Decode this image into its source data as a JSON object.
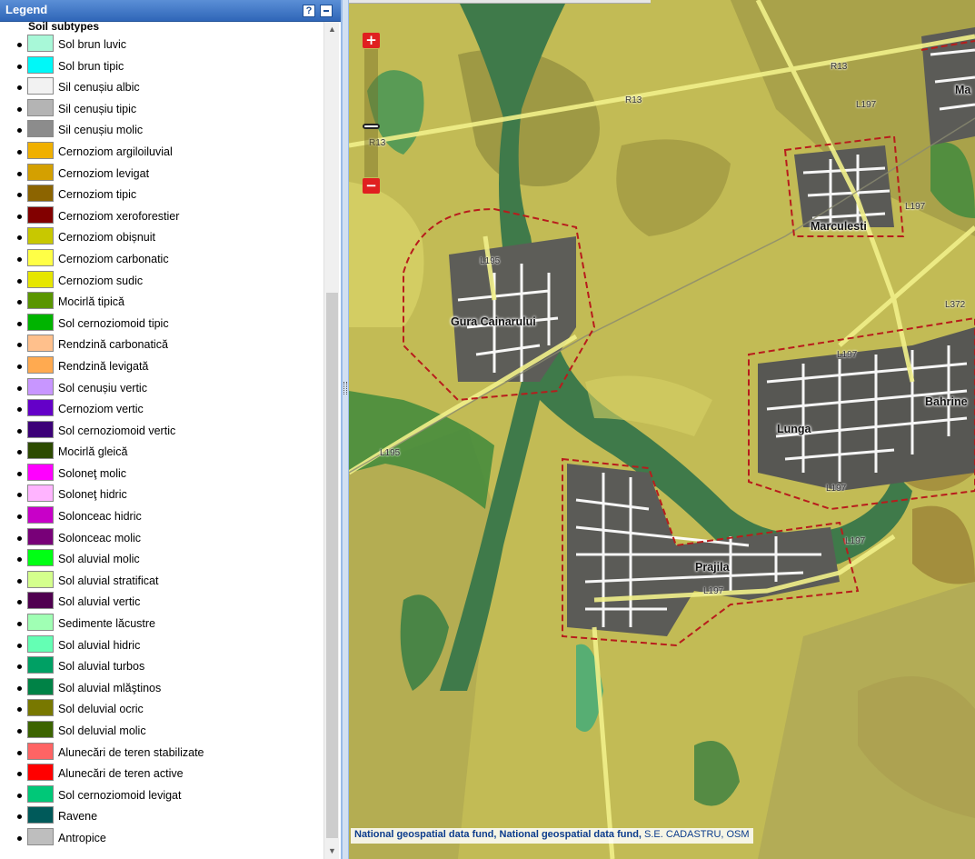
{
  "legend": {
    "title": "Legend",
    "help_label": "?",
    "subtitle": "Soil subtypes",
    "items": [
      {
        "label": "Sol brun luvic",
        "color": "#a8f8d8"
      },
      {
        "label": "Sol brun tipic",
        "color": "#00f8f8"
      },
      {
        "label": "Sil cenușiu albic",
        "color": "#f2f2f2"
      },
      {
        "label": "Sil cenușiu tipic",
        "color": "#b4b4b4"
      },
      {
        "label": "Sil cenușiu molic",
        "color": "#8c8c8c"
      },
      {
        "label": "Cernoziom argiloiluvial",
        "color": "#f0b000"
      },
      {
        "label": "Cernoziom levigat",
        "color": "#d4a000"
      },
      {
        "label": "Cernoziom tipic",
        "color": "#8c6400"
      },
      {
        "label": "Cernoziom xeroforestier",
        "color": "#820000"
      },
      {
        "label": "Cernoziom obișnuit",
        "color": "#c8c800"
      },
      {
        "label": "Cernoziom carbonatic",
        "color": "#ffff46"
      },
      {
        "label": "Cernoziom sudic",
        "color": "#e6e600"
      },
      {
        "label": "Mocirlă tipică",
        "color": "#5a9600"
      },
      {
        "label": "Sol cernoziomoid tipic",
        "color": "#00b400"
      },
      {
        "label": "Rendzină carbonatică",
        "color": "#ffc08c"
      },
      {
        "label": "Rendzină levigată",
        "color": "#ffaa50"
      },
      {
        "label": "Sol cenușiu vertic",
        "color": "#c896ff"
      },
      {
        "label": "Cernoziom vertic",
        "color": "#6400c8"
      },
      {
        "label": "Sol cernoziomoid vertic",
        "color": "#3c0078"
      },
      {
        "label": "Mocirlă gleică",
        "color": "#2d4b00"
      },
      {
        "label": "Soloneţ molic",
        "color": "#ff00ff"
      },
      {
        "label": "Soloneţ hidric",
        "color": "#ffb4ff"
      },
      {
        "label": "Solonceac hidric",
        "color": "#c800c8"
      },
      {
        "label": "Solonceac molic",
        "color": "#780078"
      },
      {
        "label": "Sol aluvial molic",
        "color": "#00ff14"
      },
      {
        "label": "Sol aluvial stratificat",
        "color": "#d4ff8c"
      },
      {
        "label": "Sol aluvial vertic",
        "color": "#500050"
      },
      {
        "label": "Sedimente lăcustre",
        "color": "#a0ffb4"
      },
      {
        "label": "Sol aluvial hidric",
        "color": "#64ffb4"
      },
      {
        "label": "Sol aluvial turbos",
        "color": "#00a064"
      },
      {
        "label": "Sol aluvial mlăştinos",
        "color": "#008246"
      },
      {
        "label": "Sol deluvial ocric",
        "color": "#787800"
      },
      {
        "label": "Sol deluvial molic",
        "color": "#3c6400"
      },
      {
        "label": "Alunecări de teren stabilizate",
        "color": "#ff6464"
      },
      {
        "label": "Alunecări de teren active",
        "color": "#ff0000"
      },
      {
        "label": "Sol cernoziomoid levigat",
        "color": "#00c878"
      },
      {
        "label": "Ravene",
        "color": "#005a5a"
      },
      {
        "label": "Antropice",
        "color": "#bebebe"
      }
    ]
  },
  "map": {
    "zoom_in_label": "+",
    "zoom_out_label": "−",
    "places": {
      "gura": "Gura Cainarului",
      "marculesti": "Marculesti",
      "lunga": "Lunga",
      "bahrinesti": "Bahrine",
      "prajila": "Prajila",
      "ma": "Ma"
    },
    "roads": {
      "r13a": "R13",
      "r13b": "R13",
      "r13c": "R13",
      "l197a": "L197",
      "l197b": "L197",
      "l197c": "L197",
      "l197d": "L197",
      "l197e": "L197",
      "l197f": "L197",
      "l195a": "L195",
      "l195b": "L195",
      "l372": "L372"
    },
    "attribution": {
      "strong": "National geospatial data fund, National geospatial data fund,",
      "rest": " S.E. CADASTRU, OSM"
    }
  }
}
